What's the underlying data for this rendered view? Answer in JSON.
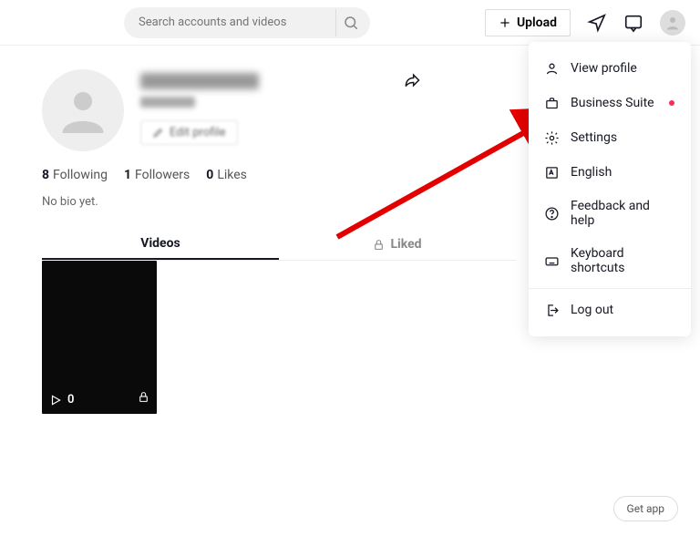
{
  "header": {
    "search_placeholder": "Search accounts and videos",
    "upload_label": "Upload"
  },
  "profile": {
    "edit_label": "Edit profile",
    "stats": {
      "following_count": "8",
      "following_label": "Following",
      "followers_count": "1",
      "followers_label": "Followers",
      "likes_count": "0",
      "likes_label": "Likes"
    },
    "bio": "No bio yet."
  },
  "tabs": {
    "videos": "Videos",
    "liked": "Liked"
  },
  "video": {
    "play_count": "0"
  },
  "menu": {
    "view_profile": "View profile",
    "business_suite": "Business Suite",
    "settings": "Settings",
    "english": "English",
    "feedback": "Feedback and help",
    "keyboard": "Keyboard shortcuts",
    "logout": "Log out"
  },
  "footer": {
    "get_app": "Get app"
  }
}
